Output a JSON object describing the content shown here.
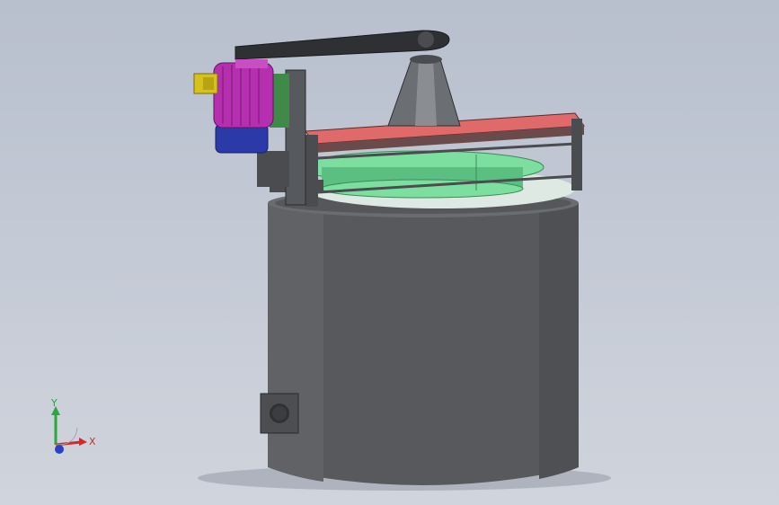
{
  "viewport": {
    "background_top": "#b8bfcd",
    "background_bottom": "#d0d4dc"
  },
  "model": {
    "tank_color": "#57595c",
    "rim_color": "#6a6d70",
    "belt_color": "#2e3033",
    "frame_color": "#4a4c50",
    "motor_color": "#b62fb0",
    "motor_base_color": "#2b3aa8",
    "terminal_box_color": "#d6c21c",
    "red_beam_color": "#e06a6a",
    "green_disc_color": "#7cdfa0",
    "port_color": "#4c4e51"
  },
  "triad": {
    "x_label": "X",
    "y_label": "Y",
    "x_color": "#d22a2a",
    "y_color": "#2aa83a",
    "z_color": "#2a40c8"
  }
}
